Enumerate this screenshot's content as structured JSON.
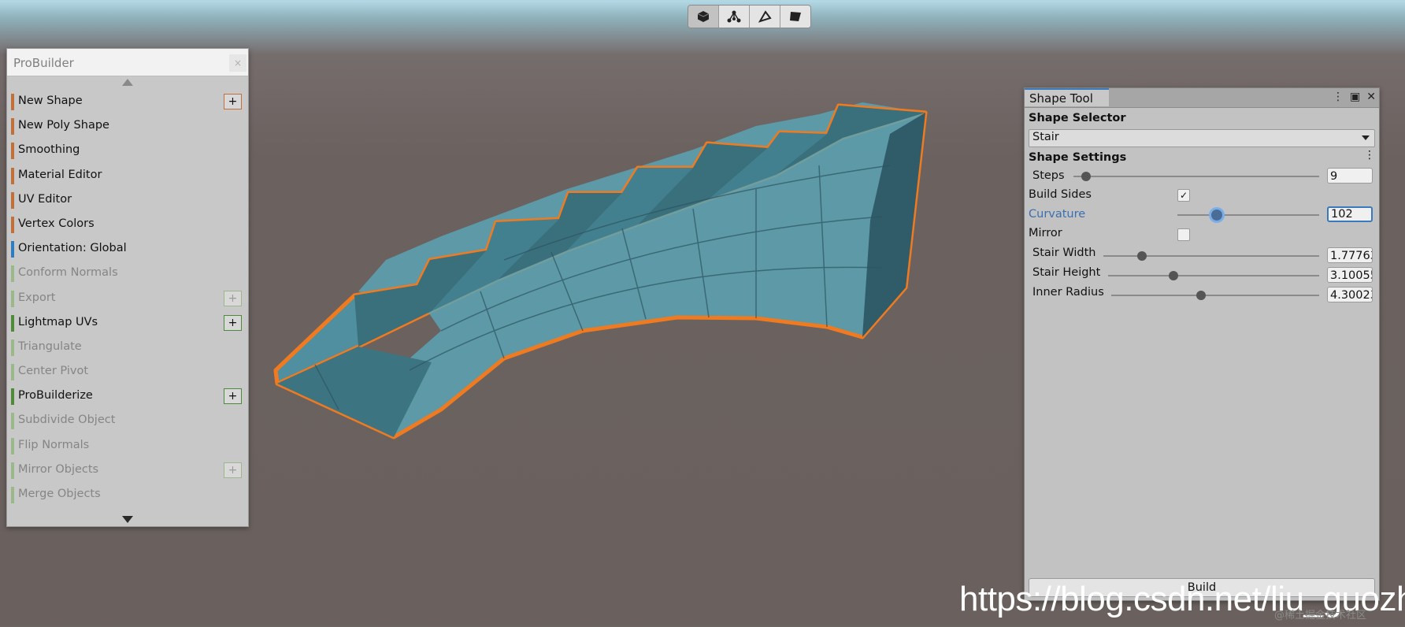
{
  "toolbar": {
    "modes": [
      {
        "icon": "object-mode-icon",
        "active": true
      },
      {
        "icon": "vertex-mode-icon",
        "active": false
      },
      {
        "icon": "edge-mode-icon",
        "active": false
      },
      {
        "icon": "face-mode-icon",
        "active": false
      }
    ]
  },
  "probuilder": {
    "title": "ProBuilder",
    "close_glyph": "×",
    "items": [
      {
        "label": "New Shape",
        "color": "#c0703a",
        "plus": true,
        "enabled": true
      },
      {
        "label": "New Poly Shape",
        "color": "#c0703a",
        "plus": false,
        "enabled": true
      },
      {
        "label": "Smoothing",
        "color": "#c0703a",
        "plus": false,
        "enabled": true
      },
      {
        "label": "Material Editor",
        "color": "#c0703a",
        "plus": false,
        "enabled": true
      },
      {
        "label": "UV Editor",
        "color": "#c0703a",
        "plus": false,
        "enabled": true
      },
      {
        "label": "Vertex Colors",
        "color": "#c0703a",
        "plus": false,
        "enabled": true
      },
      {
        "label": "Orientation: Global",
        "color": "#2f7dbf",
        "plus": false,
        "enabled": true
      },
      {
        "label": "Conform Normals",
        "color": "#9bb88a",
        "plus": false,
        "enabled": false
      },
      {
        "label": "Export",
        "color": "#9bb88a",
        "plus": true,
        "enabled": false
      },
      {
        "label": "Lightmap UVs",
        "color": "#4f8a3a",
        "plus": true,
        "enabled": true
      },
      {
        "label": "Triangulate",
        "color": "#9bb88a",
        "plus": false,
        "enabled": false
      },
      {
        "label": "Center Pivot",
        "color": "#9bb88a",
        "plus": false,
        "enabled": false
      },
      {
        "label": "ProBuilderize",
        "color": "#4f8a3a",
        "plus": true,
        "enabled": true
      },
      {
        "label": "Subdivide Object",
        "color": "#9bb88a",
        "plus": false,
        "enabled": false
      },
      {
        "label": "Flip Normals",
        "color": "#9bb88a",
        "plus": false,
        "enabled": false
      },
      {
        "label": "Mirror Objects",
        "color": "#9bb88a",
        "plus": true,
        "enabled": false
      },
      {
        "label": "Merge Objects",
        "color": "#9bb88a",
        "plus": false,
        "enabled": false
      }
    ],
    "plus_glyph": "+"
  },
  "shape_tool": {
    "tab_label": "Shape Tool",
    "shape_selector_header": "Shape Selector",
    "shape_selected": "Stair",
    "shape_settings_header": "Shape Settings",
    "steps": {
      "label": "Steps",
      "value": "9",
      "slider": 0.05
    },
    "build_sides": {
      "label": "Build Sides",
      "checked": true,
      "check_glyph": "✓"
    },
    "curvature": {
      "label": "Curvature",
      "value": "102",
      "slider": 0.28
    },
    "mirror": {
      "label": "Mirror",
      "checked": false
    },
    "stair_width": {
      "label": "Stair Width",
      "value": "1.77763",
      "slider": 0.18
    },
    "stair_height": {
      "label": "Stair Height",
      "value": "3.10055",
      "slider": 0.31
    },
    "inner_radius": {
      "label": "Inner Radius",
      "value": "4.30023",
      "slider": 0.43
    },
    "build_label": "Build"
  },
  "watermark": {
    "url": "https://blog.csdn.net/liu_guozhu",
    "small": "@稀土掘金技术社区"
  },
  "colors": {
    "mesh": "#4f8fa0",
    "outline": "#f07a20",
    "accent": "#3a79bb"
  }
}
